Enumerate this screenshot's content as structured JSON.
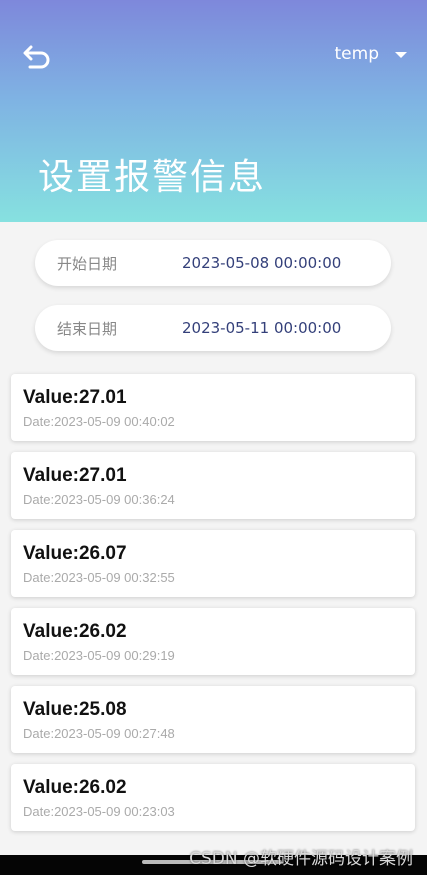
{
  "header": {
    "back_icon": "back-arrow-icon",
    "selector_value": "temp",
    "selector_icon": "caret-down-icon",
    "title": "设置报警信息",
    "gradient_colors": [
      "#7e88db",
      "#86e1e0"
    ]
  },
  "filters": {
    "start": {
      "label": "开始日期",
      "value": "2023-05-08 00:00:00"
    },
    "end": {
      "label": "结束日期",
      "value": "2023-05-11 00:00:00"
    }
  },
  "records": [
    {
      "value": "Value:27.01",
      "date": "Date:2023-05-09 00:40:02"
    },
    {
      "value": "Value:27.01",
      "date": "Date:2023-05-09 00:36:24"
    },
    {
      "value": "Value:26.07",
      "date": "Date:2023-05-09 00:32:55"
    },
    {
      "value": "Value:26.02",
      "date": "Date:2023-05-09 00:29:19"
    },
    {
      "value": "Value:25.08",
      "date": "Date:2023-05-09 00:27:48"
    },
    {
      "value": "Value:26.02",
      "date": "Date:2023-05-09 00:23:03"
    }
  ],
  "watermark": "CSDN @软硬件源码设计案例"
}
